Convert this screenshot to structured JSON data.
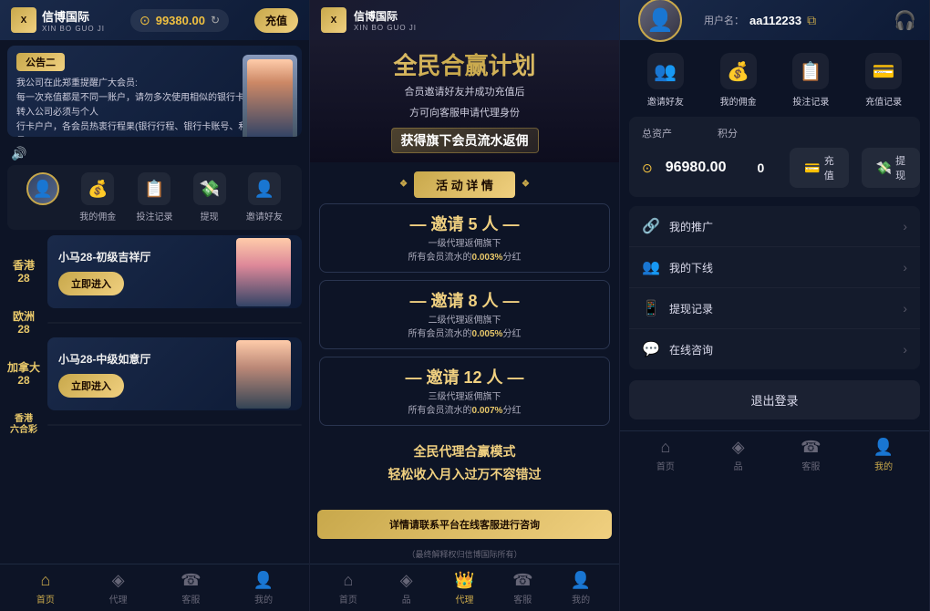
{
  "panel1": {
    "logo": {
      "icon": "X",
      "name": "信博国际",
      "sub": "XIN BO GUO JI"
    },
    "balance": {
      "amount": "99380.00",
      "refresh": "↻"
    },
    "recharge_btn": "充值",
    "banner": {
      "title": "公告二",
      "lines": [
        "我公司在此郑重提醒广大会员:",
        "每一次充值都是不同一账户，请勿多次使用相似的银行卡转账，私人转入公司必须与个人",
        "行卡户户，各会员热衷行程果(银行行程、银行卡账号、和银行卡账号)"
      ]
    },
    "nav_items": [
      {
        "label": "我的佣金",
        "icon": "💰"
      },
      {
        "label": "投注记录",
        "icon": "📋"
      },
      {
        "label": "提现",
        "icon": "💸"
      },
      {
        "label": "邀请好友",
        "icon": "👤"
      }
    ],
    "games": [
      {
        "tag": "香港\n28",
        "title": "小马28-初级吉祥厅",
        "btn": "立即进入"
      },
      {
        "tag": "欧洲\n28",
        "title": "",
        "btn": ""
      },
      {
        "tag": "加拿大\n28",
        "title": "小马28-中级如意厅",
        "btn": "立即进入"
      },
      {
        "tag": "香港\n六合彩",
        "title": "",
        "btn": ""
      }
    ],
    "bottom_nav": [
      {
        "label": "首页",
        "active": true
      },
      {
        "label": "代理",
        "active": false
      },
      {
        "label": "客服",
        "active": false
      },
      {
        "label": "我的",
        "active": false
      }
    ]
  },
  "panel2": {
    "logo": {
      "icon": "X",
      "name": "信博国际",
      "sub": "XIN BO GUO JI"
    },
    "hero": {
      "title": "全民合赢计划",
      "sub1": "合员邀请好友并成功充值后",
      "sub2": "方可向客服申请代理身份",
      "tag": "获得旗下会员流水返佣"
    },
    "section_title": "活 动 详 情",
    "invite_levels": [
      {
        "num": "— 邀请 5 人 —",
        "desc1": "一级代理返佣旗下",
        "desc2": "所有会员流水的",
        "highlight": "0.003%",
        "desc3": "分红"
      },
      {
        "num": "— 邀请 8 人 —",
        "desc1": "二级代理返佣旗下",
        "desc2": "所有会员流水的",
        "highlight": "0.005%",
        "desc3": "分红"
      },
      {
        "num": "— 邀请 12 人 —",
        "desc1": "三级代理返佣旗下",
        "desc2": "所有会员流水的",
        "highlight": "0.007%",
        "desc3": "分红"
      }
    ],
    "promo_text": "全民代理合赢模式\n轻松收入月入过万不容错过",
    "footer_banner": "详情请联系平台在线客服进行咨询",
    "footer_note": "（最终解释权归信博国际所有）",
    "bottom_nav": [
      {
        "label": "首页",
        "active": false
      },
      {
        "label": "品",
        "active": false
      },
      {
        "label": "代理",
        "active": true
      },
      {
        "label": "客服",
        "active": false
      },
      {
        "label": "我的",
        "active": false
      }
    ]
  },
  "panel3": {
    "user": {
      "label": "用户名：",
      "name": "aa112233",
      "copy_icon": "📋"
    },
    "quick_nav": [
      {
        "label": "邀请好友",
        "icon": "👥"
      },
      {
        "label": "我的佣金",
        "icon": "💰"
      },
      {
        "label": "投注记录",
        "icon": "📋"
      },
      {
        "label": "充值记录",
        "icon": "💳"
      }
    ],
    "assets": {
      "total_label": "总资产",
      "total_value": "96980.00",
      "score_label": "积分",
      "score_value": "0",
      "recharge_btn": "充值",
      "withdraw_btn": "提现"
    },
    "menu_items": [
      {
        "icon": "🔗",
        "label": "我的推广"
      },
      {
        "icon": "👥",
        "label": "我的下线"
      },
      {
        "icon": "📱",
        "label": "提现记录"
      },
      {
        "icon": "💬",
        "label": "在线咨询"
      }
    ],
    "logout_btn": "退出登录",
    "bottom_nav": [
      {
        "label": "首页",
        "active": false
      },
      {
        "label": "品",
        "active": false
      },
      {
        "label": "客服",
        "active": false
      },
      {
        "label": "我的",
        "active": true
      }
    ]
  }
}
